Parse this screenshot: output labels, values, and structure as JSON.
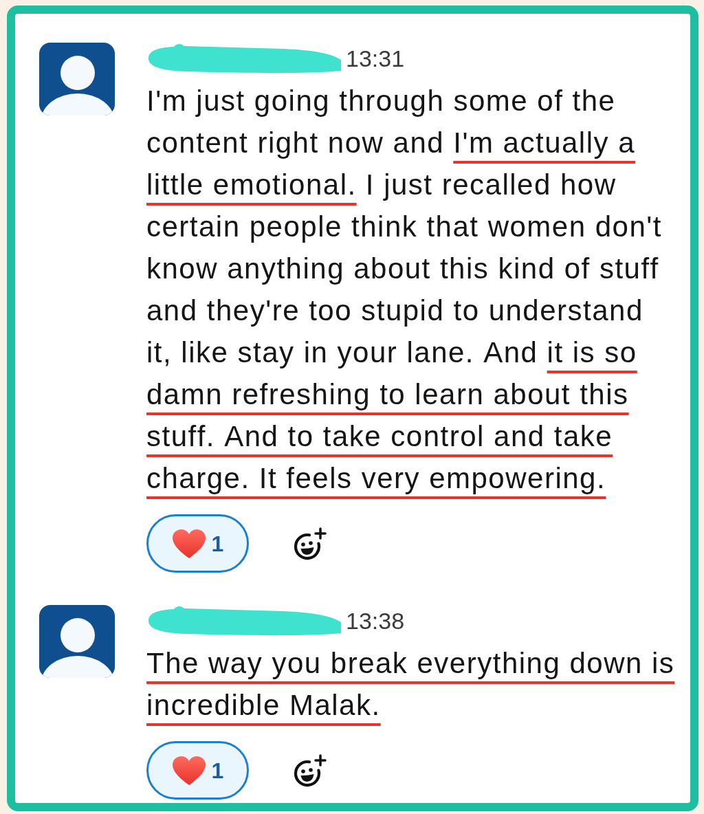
{
  "messages": [
    {
      "name_redacted": true,
      "time": "13:31",
      "segments": [
        {
          "text": "I'm just going through some of the content right now and ",
          "underlined": false
        },
        {
          "text": "I'm actually a little emotional.",
          "underlined": true
        },
        {
          "text": " I just recalled how certain people think that women don't know anything about this kind of stuff and they're too stupid to understand it, like stay in your lane. And ",
          "underlined": false
        },
        {
          "text": "it is so damn refreshing to learn about this stuff. And to take control and take charge. It feels very empowering.",
          "underlined": true
        }
      ],
      "reaction": {
        "count": "1",
        "reacted": true
      }
    },
    {
      "name_redacted": true,
      "time": "13:38",
      "segments": [
        {
          "text": "The way you break everything down is incredible Malak.",
          "underlined": true
        }
      ],
      "reaction": {
        "count": "1",
        "reacted": true
      }
    }
  ]
}
